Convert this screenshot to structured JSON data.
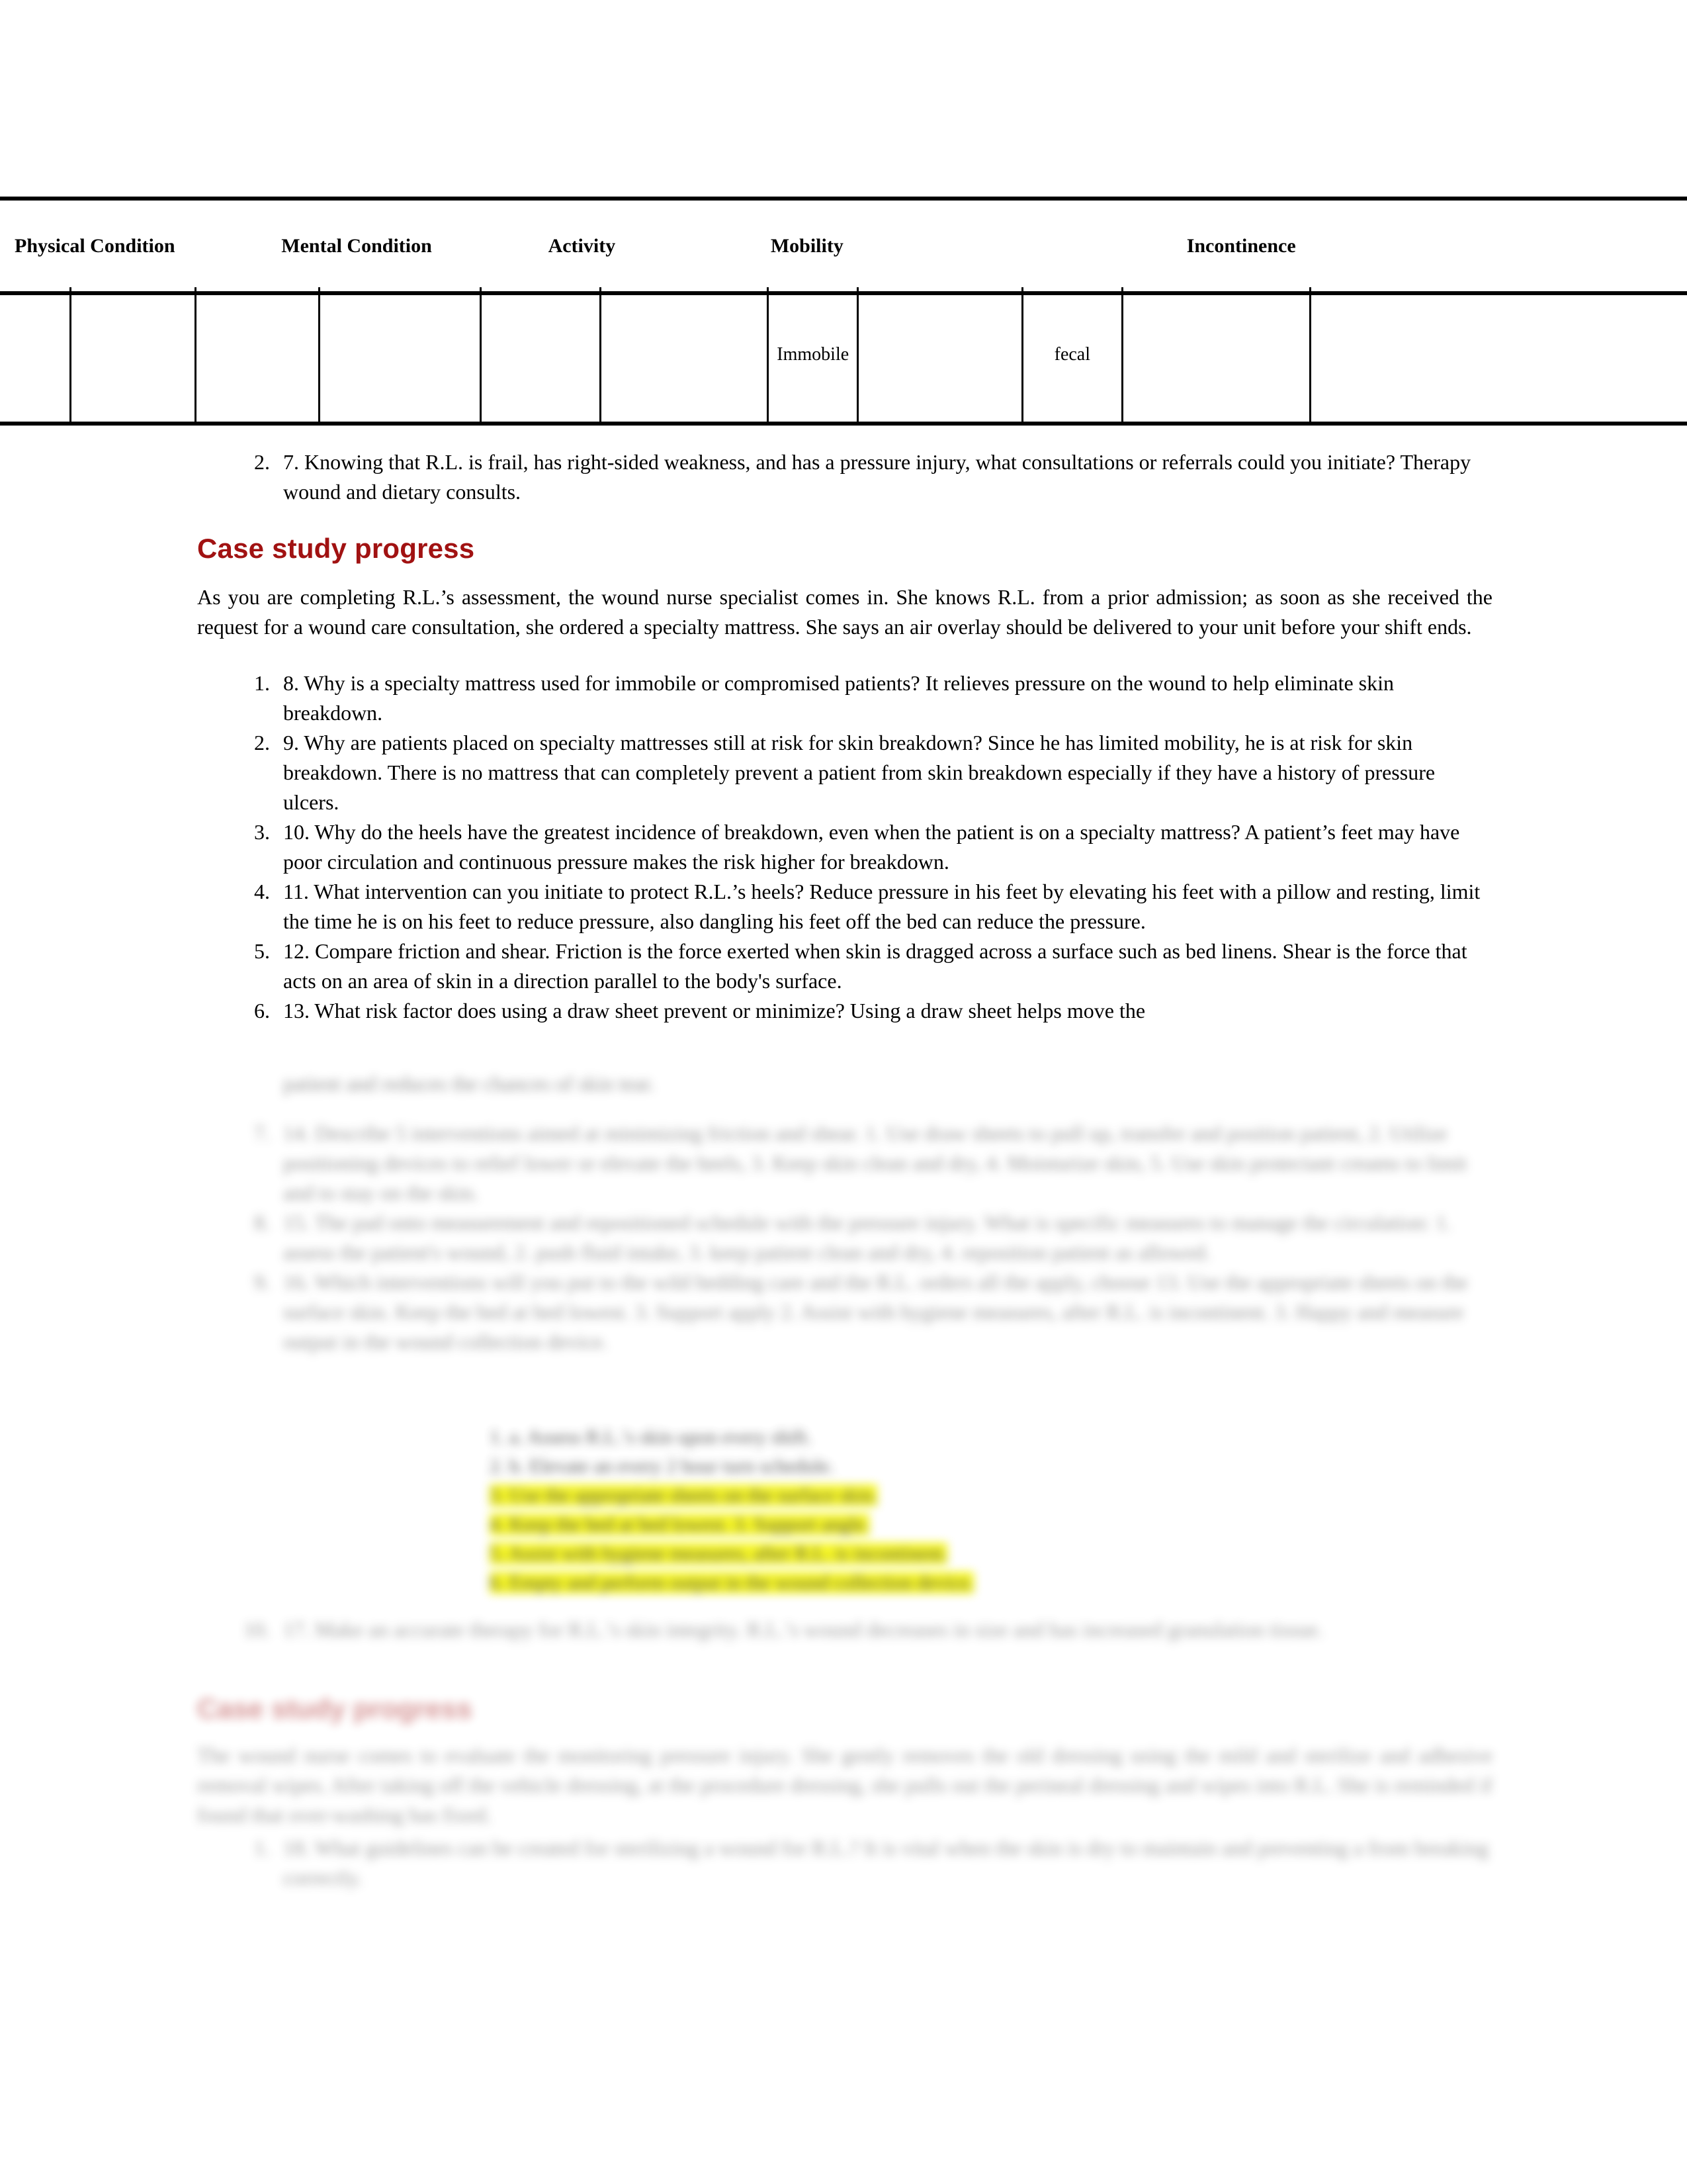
{
  "colors": {
    "heading_red": "#A11212",
    "highlight_yellow": "#F5F500",
    "text_black": "#000000",
    "table_border": "#000000"
  },
  "table": {
    "name": "pressure-injury-risk-assessment-table",
    "headers": [
      "Physical Condition",
      "Mental Condition",
      "Activity",
      "Mobility",
      "Incontinence"
    ],
    "row_values": [
      "",
      "",
      "",
      "",
      "",
      "",
      "Immobile",
      "",
      "fecal",
      "",
      ""
    ]
  },
  "top_item": {
    "number": "2.",
    "text": "7. Knowing that R.L. is frail, has right-sided weakness, and has a pressure injury, what consultations or referrals could you initiate? Therapy wound and dietary consults."
  },
  "section_1": {
    "heading": "Case study progress",
    "intro": "As you are completing R.L.’s assessment, the wound nurse specialist comes in. She knows R.L. from a prior admission; as soon as she received the request for a wound care consultation, she ordered a specialty mattress. She says an air overlay should be delivered to your unit before your shift ends.",
    "items": [
      {
        "number": "1.",
        "text": "8. Why is a specialty mattress used for immobile or compromised patients? It relieves pressure on the wound to help eliminate skin breakdown."
      },
      {
        "number": "2.",
        "text": "9. Why are patients placed on specialty mattresses still at risk for skin breakdown? Since he has limited mobility, he is at risk for skin breakdown. There is no mattress that can completely prevent a patient from skin breakdown especially if they have a history of pressure ulcers."
      },
      {
        "number": "3.",
        "text": "10. Why do the heels have the greatest incidence of breakdown, even when the patient is on a specialty mattress? A patient’s feet may have poor circulation and continuous pressure makes the risk higher for breakdown."
      },
      {
        "number": "4.",
        "text": "11. What intervention can you initiate to protect R.L.’s heels? Reduce pressure in his feet by elevating his feet with a pillow and resting, limit the time he is on his feet to reduce pressure, also dangling his feet off the bed can reduce the pressure."
      },
      {
        "number": "5.",
        "text": "12. Compare friction and shear. Friction is the force exerted when skin is dragged across a surface such as bed linens. Shear is the force that acts on an area of skin in a direction parallel to the body's surface."
      },
      {
        "number": "6.",
        "text": "13. What risk factor does using a draw sheet prevent or minimize? Using a draw sheet helps move the"
      }
    ]
  },
  "obscured": {
    "note": "illegible blurred text",
    "item_6_continuation": "patient and reduces the chances of skin tear.",
    "items": [
      {
        "number": "7.",
        "text": "14. Describe 5 interventions aimed at minimizing friction and shear. 1. Use draw sheets to pull up, transfer and position patient, 2. Utilize positioning devices to relief lower or elevate the heels, 3. Keep skin clean and dry, 4. Moisturize skin, 5. Use skin protectant creams to limit and to stay on the skin."
      },
      {
        "number": "8.",
        "text": "15. The pad onto measurement and repositioned schedule with the pressure injury. What is specific measures to manage the circulation: 1. assess the patient's wound, 2. push fluid intake, 3. keep patient clean and dry, 4. reposition patient as allowed."
      },
      {
        "number": "9.",
        "text": "16. Which interventions will you put to the wild bedding care and the R.L. orders all the apply, choose 13. Use the appropriate sheets on the surface skin. Keep the bed at bed lowest. 3. Support apply 2. Assist with hygiene measures, after R.L. is incontinent. 3. Happy and measure output in the wound collection device."
      }
    ],
    "checklist": [
      {
        "highlighted": false,
        "text": "1. a. Assess R.L.’s skin upon every shift."
      },
      {
        "highlighted": false,
        "text": "2. b. Elevate an every 2 hour turn schedule."
      },
      {
        "highlighted": true,
        "text": "3. Use the appropriate sheets on the surface skin."
      },
      {
        "highlighted": true,
        "text": "4. Keep the bed at bed lowest. 3. Support angle."
      },
      {
        "highlighted": true,
        "text": "5. Assist with hygiene measures, after R.L. is incontinent."
      },
      {
        "highlighted": true,
        "text": "6. Empty and perform output in the wound collection device."
      }
    ],
    "last_item": {
      "number": "10.",
      "text": "17. Make an accurate therapy for R.L.’s skin integrity. R.L.’s wound decreases in size and has increased granulation tissue."
    },
    "section_2": {
      "heading": "Case study progress",
      "paragraph": "The wound nurse comes to evaluate the monitoring pressure injury. She gently removes the old dressing using the mild and sterilize and adhesive removal wipes. After taking off the vehicle dressing, at the procedure dressing, she pulls out the perineal dressing and wipes into R.L. She is reminded if found that over-washing has fixed.",
      "items": [
        {
          "number": "1.",
          "text": "18. What guidelines can be created for sterilizing a wound for R.L.? It is vital when the skin is dry to maintain and preventing a from breaking correctly."
        }
      ]
    }
  }
}
